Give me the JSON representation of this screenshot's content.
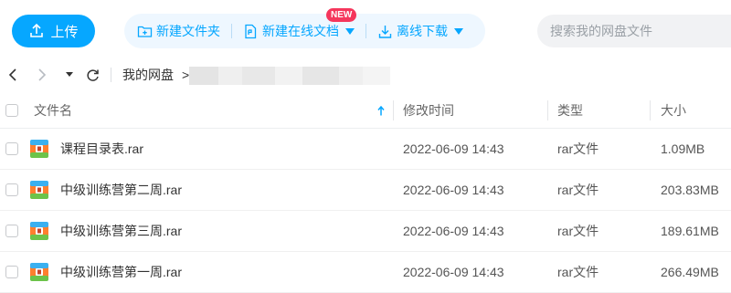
{
  "toolbar": {
    "upload_label": "上传",
    "new_folder_label": "新建文件夹",
    "new_doc_label": "新建在线文档",
    "new_badge": "NEW",
    "offline_download_label": "离线下载"
  },
  "search": {
    "placeholder": "搜索我的网盘文件"
  },
  "breadcrumb": {
    "root": "我的网盘",
    "separator": ">"
  },
  "table": {
    "columns": [
      "文件名",
      "修改时间",
      "类型",
      "大小"
    ],
    "rows": [
      {
        "name": "课程目录表.rar",
        "modified": "2022-06-09 14:43",
        "type": "rar文件",
        "size": "1.09MB"
      },
      {
        "name": "中级训练营第二周.rar",
        "modified": "2022-06-09 14:43",
        "type": "rar文件",
        "size": "203.83MB"
      },
      {
        "name": "中级训练营第三周.rar",
        "modified": "2022-06-09 14:43",
        "type": "rar文件",
        "size": "189.61MB"
      },
      {
        "name": "中级训练营第一周.rar",
        "modified": "2022-06-09 14:43",
        "type": "rar文件",
        "size": "266.49MB"
      }
    ]
  },
  "colors": {
    "accent": "#06a7ff",
    "badge": "#f5365c"
  }
}
